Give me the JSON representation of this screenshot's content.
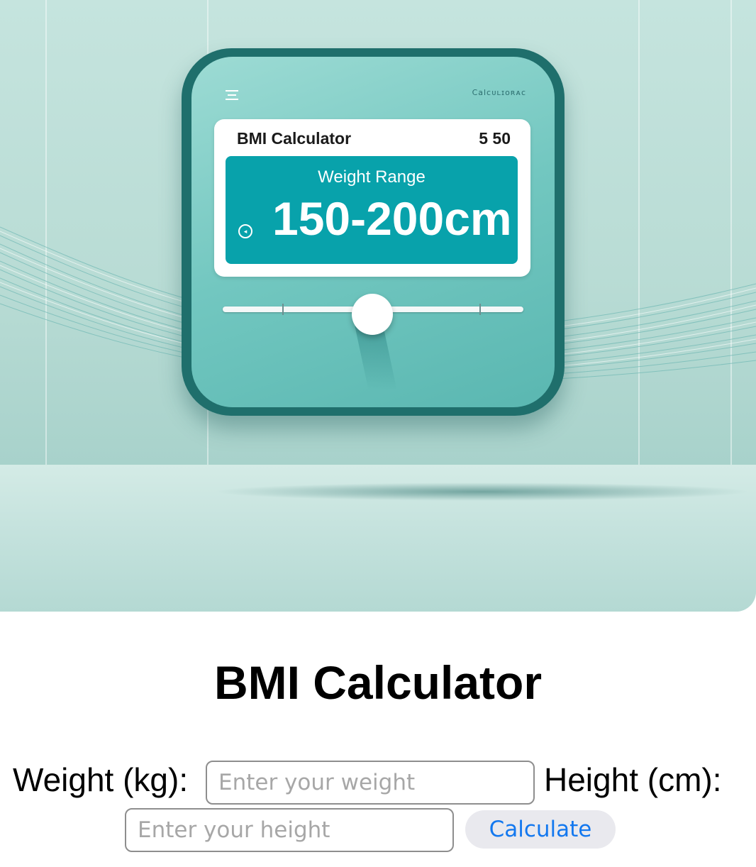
{
  "hero_image": {
    "device_brand": "Calcᴜʟɪᴏʀᴀᴄ",
    "card_title": "BMI Calculator",
    "card_number": "5 50",
    "range_label": "Weight Range",
    "range_value": "150-200cm",
    "colors": {
      "background": "#c5e4de",
      "device_frame": "#1f6f6c",
      "device_face": "#72c7c0",
      "display_panel": "#08a2ab"
    },
    "icons": [
      "menu-icon",
      "sound-icon"
    ]
  },
  "page": {
    "title": "BMI Calculator"
  },
  "form": {
    "weight_label": "Weight (kg):",
    "weight_placeholder": "Enter your weight",
    "weight_value": "",
    "height_label": "Height (cm):",
    "height_placeholder": "Enter your height",
    "height_value": "",
    "calculate_label": "Calculate"
  },
  "colors": {
    "button_text": "#1378ef",
    "button_bg": "#e9e9ee",
    "input_border": "#8e8e8e"
  }
}
